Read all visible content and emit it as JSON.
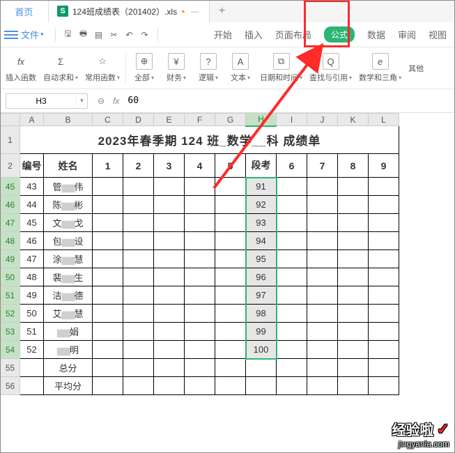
{
  "titlebar": {
    "home": "首页",
    "doc_icon": "S",
    "doc_name": "124班成绩表（201402）.xls",
    "newtab": "+"
  },
  "menubar": {
    "file": "文件",
    "tabs": {
      "start": "开始",
      "insert": "插入",
      "layout": "页面布局",
      "formula": "公式",
      "data": "数据",
      "review": "审阅",
      "view": "视图"
    }
  },
  "ribbon": {
    "insert_fn": {
      "icon": "fx",
      "label": "插入函数"
    },
    "autosum": {
      "icon": "Σ",
      "label": "自动求和"
    },
    "common": {
      "icon": "☆",
      "label": "常用函数"
    },
    "all": {
      "icon": "⊕",
      "label": "全部"
    },
    "finance": {
      "icon": "¥",
      "label": "财务"
    },
    "logic": {
      "icon": "?",
      "label": "逻辑"
    },
    "text": {
      "icon": "A",
      "label": "文本"
    },
    "datetime": {
      "icon": "⧉",
      "label": "日期和时间"
    },
    "lookup": {
      "icon": "Q",
      "label": "查找与引用"
    },
    "math": {
      "icon": "e",
      "label": "数学和三角"
    },
    "other": {
      "label": "其他"
    }
  },
  "formrow": {
    "namebox": "H3",
    "fx": "fx",
    "formula": "60"
  },
  "colheads": [
    "A",
    "B",
    "C",
    "D",
    "E",
    "F",
    "G",
    "H",
    "I",
    "J",
    "K",
    "L"
  ],
  "title": "2023年春季期 124 班_数学__科 成绩单",
  "headers": {
    "A": "编号",
    "B": "姓名",
    "C": "1",
    "D": "2",
    "E": "3",
    "F": "4",
    "G": "5",
    "H": "段考",
    "I": "6",
    "J": "7",
    "K": "8",
    "L": "9"
  },
  "rows": [
    {
      "rh": "45",
      "a": "43",
      "b_l": "管",
      "b_r": "伟",
      "h": "91"
    },
    {
      "rh": "46",
      "a": "44",
      "b_l": "陈",
      "b_r": "彬",
      "h": "92"
    },
    {
      "rh": "47",
      "a": "45",
      "b_l": "文",
      "b_r": "戈",
      "h": "93"
    },
    {
      "rh": "48",
      "a": "46",
      "b_l": "包",
      "b_r": "设",
      "h": "94"
    },
    {
      "rh": "49",
      "a": "47",
      "b_l": "涂",
      "b_r": "慧",
      "h": "95"
    },
    {
      "rh": "50",
      "a": "48",
      "b_l": "裴",
      "b_r": "生",
      "h": "96"
    },
    {
      "rh": "51",
      "a": "49",
      "b_l": "洁",
      "b_r": "德",
      "h": "97"
    },
    {
      "rh": "52",
      "a": "50",
      "b_l": "艾",
      "b_r": "慧",
      "h": "98"
    },
    {
      "rh": "53",
      "a": "51",
      "b_l": "",
      "b_r": "娟",
      "h": "99"
    },
    {
      "rh": "54",
      "a": "52",
      "b_l": "",
      "b_r": "明",
      "h": "100"
    }
  ],
  "footer": {
    "r55": "55",
    "r56": "56",
    "total": "总分",
    "avg": "平均分"
  },
  "watermark": {
    "brand": "经验啦",
    "url": "jingyanla.com"
  }
}
